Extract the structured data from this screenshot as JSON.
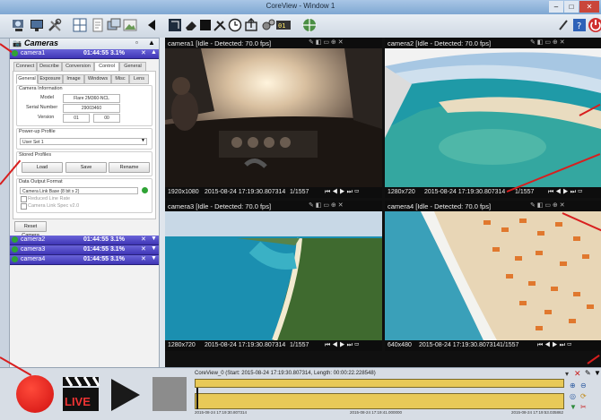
{
  "window": {
    "title": "CoreView - Window 1"
  },
  "left_panel": {
    "header": "Cameras",
    "cameras": [
      {
        "label": "camera1",
        "time": "01:44:55 3.1%"
      },
      {
        "label": "camera2",
        "time": "01:44:55 3.1%"
      },
      {
        "label": "camera3",
        "time": "01:44:55 3.1%"
      },
      {
        "label": "camera4",
        "time": "01:44:55 3.1%"
      }
    ],
    "tabs": [
      "Connect",
      "Describe",
      "Conversion",
      "Control",
      "General"
    ],
    "subtabs": [
      "General",
      "Exposure",
      "Image",
      "Windows",
      "Misc",
      "Lens"
    ],
    "camera_info": {
      "title": "Camera Information",
      "model_label": "Model",
      "model_value": "Flare 2M360-NCL",
      "serial_label": "Serial Number",
      "serial_value": "29003460",
      "version_label": "Version",
      "version_a": "01",
      "version_b": "00"
    },
    "powerup": {
      "title": "Power-up Profile",
      "value": "User Set 1"
    },
    "stored": {
      "title": "Stored Profiles",
      "load": "Load",
      "save": "Save",
      "rename": "Rename"
    },
    "output": {
      "title": "Data Output Format",
      "value": "Camera Link Base (8 bit x 2)",
      "opt1": "Reduced Line Rate",
      "opt2": "Camera Link Spec v2.0"
    },
    "reset": "Reset Camera"
  },
  "videos": [
    {
      "header": "camera1  [Idle - Detected: 70.0 fps]",
      "res": "1920x1080",
      "ts": "2015-08-24 17:19:30.807314",
      "count": "1/1557"
    },
    {
      "header": "camera2  [Idle - Detected: 70.0 fps]",
      "res": "1280x720",
      "ts": "2015-08-24 17:19:30.807314",
      "count": "1/1557"
    },
    {
      "header": "camera3  [Idle - Detected: 70.0 fps]",
      "res": "1280x720",
      "ts": "2015-08-24 17:19:30.807314",
      "count": "1/1557"
    },
    {
      "header": "camera4  [Idle - Detected: 70.0 fps]",
      "res": "640x480",
      "ts": "2015-08-24 17:19:30.807314",
      "count": "1/1557"
    }
  ],
  "timeline": {
    "title": "CoreView_0 (Start: 2015-08-24 17:19:30.807314, Length: 00:00:22.228548)",
    "start_label": "2015-08-24 17:19:30.807314",
    "mid_label": "2015-08-24 17:19:41.000000",
    "end_label": "2015-08-24 17:19:53.035862",
    "live_label": "LIVE"
  },
  "colors": {
    "annotation_arrow": "#d81e1e",
    "camera_header": "#4a43c4",
    "timeline_fill": "#e8c957"
  }
}
